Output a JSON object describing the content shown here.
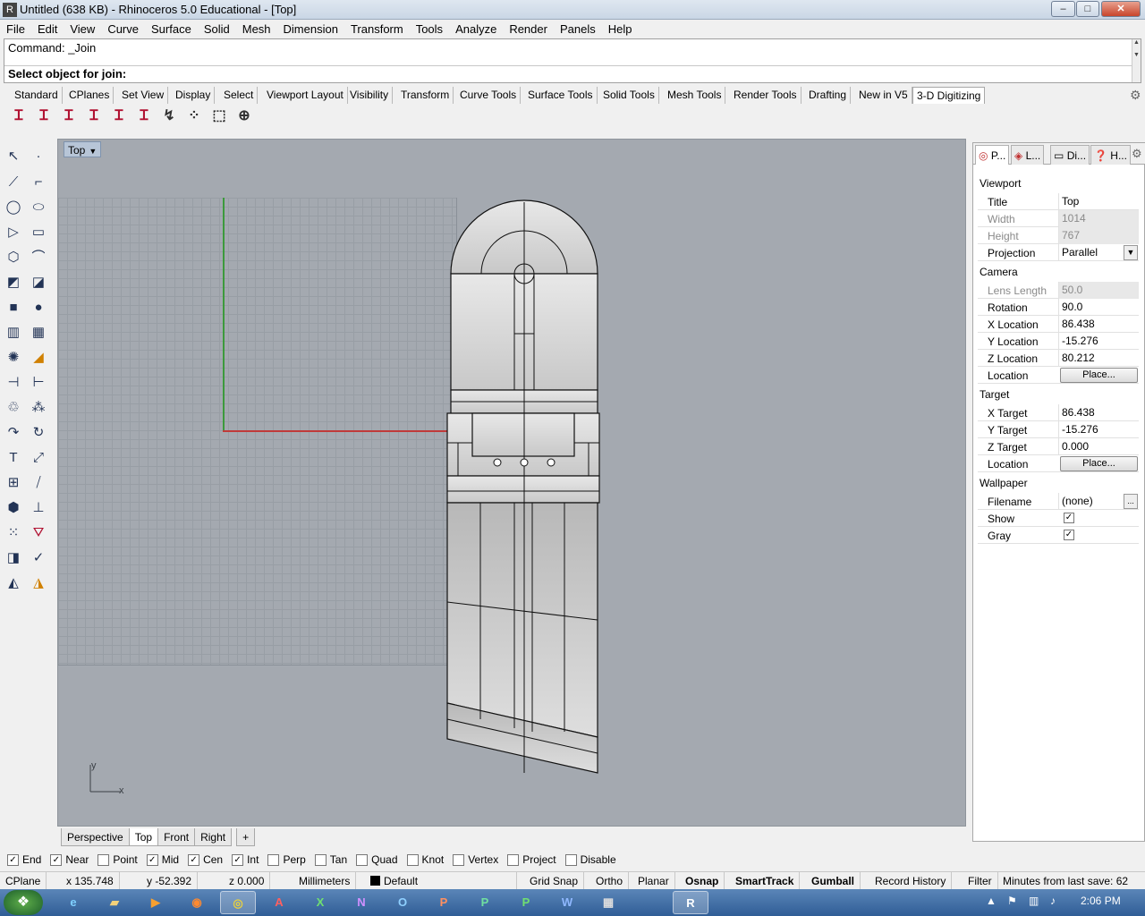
{
  "titlebar": {
    "title": "Untitled (638 KB) - Rhinoceros 5.0 Educational - [Top]",
    "min": "–",
    "max": "□",
    "close": "✕"
  },
  "menu": [
    "File",
    "Edit",
    "View",
    "Curve",
    "Surface",
    "Solid",
    "Mesh",
    "Dimension",
    "Transform",
    "Tools",
    "Analyze",
    "Render",
    "Panels",
    "Help"
  ],
  "command": {
    "history": "Command: _Join",
    "prompt": "Select object for join:"
  },
  "toolbar_tabs": [
    "Standard",
    "CPlanes",
    "Set View",
    "Display",
    "Select",
    "Viewport Layout",
    "Visibility",
    "Transform",
    "Curve Tools",
    "Surface Tools",
    "Solid Tools",
    "Mesh Tools",
    "Render Tools",
    "Drafting",
    "New in V5",
    "3-D Digitizing"
  ],
  "active_toolbar_tab": "3-D Digitizing",
  "viewport": {
    "label": "Top",
    "axis_x": "x",
    "axis_y": "y"
  },
  "viewport_tabs": [
    "Perspective",
    "Top",
    "Front",
    "Right"
  ],
  "active_viewport_tab": "Top",
  "panel": {
    "tabs": [
      "P...",
      "L...",
      "Di...",
      "H..."
    ],
    "sections": {
      "viewport": "Viewport",
      "camera": "Camera",
      "target": "Target",
      "wallpaper": "Wallpaper"
    },
    "viewport_props": {
      "title_k": "Title",
      "title_v": "Top",
      "width_k": "Width",
      "width_v": "1014",
      "height_k": "Height",
      "height_v": "767",
      "proj_k": "Projection",
      "proj_v": "Parallel"
    },
    "camera_props": {
      "lens_k": "Lens Length",
      "lens_v": "50.0",
      "rot_k": "Rotation",
      "rot_v": "90.0",
      "xl_k": "X Location",
      "xl_v": "86.438",
      "yl_k": "Y Location",
      "yl_v": "-15.276",
      "zl_k": "Z Location",
      "zl_v": "80.212",
      "loc_k": "Location",
      "loc_btn": "Place..."
    },
    "target_props": {
      "xt_k": "X Target",
      "xt_v": "86.438",
      "yt_k": "Y Target",
      "yt_v": "-15.276",
      "zt_k": "Z Target",
      "zt_v": "0.000",
      "loc_k": "Location",
      "loc_btn": "Place..."
    },
    "wallpaper_props": {
      "file_k": "Filename",
      "file_v": "(none)",
      "file_btn": "...",
      "show_k": "Show",
      "gray_k": "Gray",
      "show_checked": true,
      "gray_checked": true
    }
  },
  "osnaps": [
    {
      "label": "End",
      "checked": true
    },
    {
      "label": "Near",
      "checked": true
    },
    {
      "label": "Point",
      "checked": false
    },
    {
      "label": "Mid",
      "checked": true
    },
    {
      "label": "Cen",
      "checked": true
    },
    {
      "label": "Int",
      "checked": true
    },
    {
      "label": "Perp",
      "checked": false
    },
    {
      "label": "Tan",
      "checked": false
    },
    {
      "label": "Quad",
      "checked": false
    },
    {
      "label": "Knot",
      "checked": false
    },
    {
      "label": "Vertex",
      "checked": false
    },
    {
      "label": "Project",
      "checked": false
    },
    {
      "label": "Disable",
      "checked": false
    }
  ],
  "status": {
    "cplane": "CPlane",
    "x": "x 135.748",
    "y": "y -52.392",
    "z": "z 0.000",
    "units": "Millimeters",
    "layer": "Default",
    "gridsnap": "Grid Snap",
    "ortho": "Ortho",
    "planar": "Planar",
    "osnap": "Osnap",
    "smarttrack": "SmartTrack",
    "gumball": "Gumball",
    "record": "Record History",
    "filter": "Filter",
    "minutes": "Minutes from last save: 62"
  },
  "taskbar": {
    "clock": "2:06 PM",
    "apps": [
      "IE",
      "Folder",
      "Media",
      "Firefox",
      "Chrome",
      "Access",
      "Excel",
      "OneNote",
      "Outlook",
      "PowerPoint",
      "Publisher",
      "Project",
      "Word",
      "Calc",
      "Rhino"
    ]
  },
  "colors": {
    "viewport_bg": "#a4a9b0",
    "x_axis": "#c03a3a",
    "y_axis": "#3c9a3c",
    "taskbar": "#2f5d96"
  }
}
